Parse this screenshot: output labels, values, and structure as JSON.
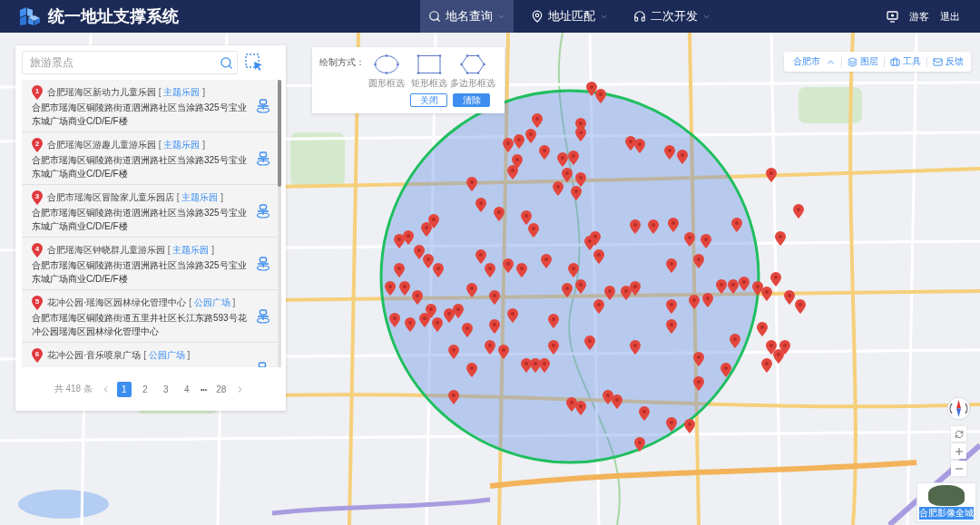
{
  "header": {
    "title": "统一地址支撑系统",
    "nav": [
      {
        "label": "地名查询",
        "selected": true
      },
      {
        "label": "地址匹配",
        "selected": false
      },
      {
        "label": "二次开发",
        "selected": false
      }
    ],
    "user": "游客",
    "logout": "退出"
  },
  "search_panel": {
    "search": {
      "placeholder": "旅游景点"
    },
    "results": [
      {
        "index": "1",
        "name": "合肥瑶海区新动力儿童乐园",
        "category": {
          "open": "[",
          "label": "主题乐园",
          "close": "]"
        },
        "address": "合肥市瑶海区铜陵路街道泗洲路社区当涂路325号宝业东城广场商业C/D/E/F楼"
      },
      {
        "index": "2",
        "name": "合肥瑶海区游趣儿童游乐园",
        "category": {
          "open": "[",
          "label": "主题乐园",
          "close": "]"
        },
        "address": "合肥市瑶海区铜陵路街道泗洲路社区当涂路325号宝业东城广场商业C/D/E/F楼"
      },
      {
        "index": "3",
        "name": "合肥市瑶海区冒险家儿童乐园店",
        "category": {
          "open": "[",
          "label": "主题乐园",
          "close": "]"
        },
        "address": "合肥市瑶海区铜陵路街道泗洲路社区当涂路325号宝业东城广场商业C/D/E/F楼"
      },
      {
        "index": "4",
        "name": "合肥瑶海区钟晓群儿童游乐园",
        "category": {
          "open": "[",
          "label": "主题乐园",
          "close": "]"
        },
        "address": "合肥市瑶海区铜陵路街道泗洲路社区当涂路325号宝业东城广场商业C/D/E/F楼"
      },
      {
        "index": "5",
        "name": "花冲公园·瑶海区园林绿化管理中心",
        "category": {
          "open": "[",
          "label": "公园广场",
          "close": "]"
        },
        "address": "合肥市瑶海区铜陵路街道五里井社区长江东路593号花冲公园瑶海区园林绿化管理中心"
      },
      {
        "index": "6",
        "name": "花冲公园·音乐喷泉广场",
        "category": {
          "open": "[",
          "label": "公园广场",
          "close": "]"
        }
      }
    ],
    "pagination": {
      "total": "共 418 条",
      "pages": [
        {
          "kind": "page",
          "label": "1",
          "selected": true
        },
        {
          "kind": "page",
          "label": "2",
          "selected": false
        },
        {
          "kind": "page",
          "label": "3",
          "selected": false
        },
        {
          "kind": "page",
          "label": "4",
          "selected": false
        },
        {
          "kind": "ellipsis",
          "label": "•••",
          "selected": false
        },
        {
          "kind": "page",
          "label": "28",
          "selected": false
        }
      ]
    }
  },
  "draw_panel": {
    "label": "绘制方式：",
    "methods": [
      {
        "label": "圆形框选"
      },
      {
        "label": "矩形框选"
      },
      {
        "label": "多边形框选"
      }
    ],
    "buttons": [
      {
        "kind": "outline",
        "label": "关闭"
      },
      {
        "kind": "primary",
        "label": "清除"
      }
    ]
  },
  "toolbar": {
    "city": "合肥市",
    "items": [
      {
        "label": "图层"
      },
      {
        "label": "工具"
      },
      {
        "label": "反馈"
      }
    ]
  },
  "basemap": {
    "label": "合肥影像全城"
  }
}
